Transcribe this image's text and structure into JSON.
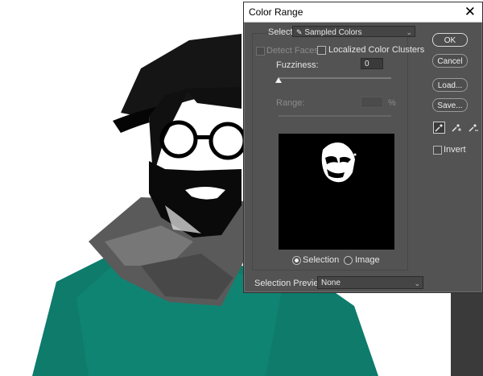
{
  "dialog": {
    "title": "Color Range",
    "close_glyph": "✕",
    "select_label": "Select:",
    "select_value": "Sampled Colors",
    "detect_faces_label": "Detect Faces",
    "localized_clusters_label": "Localized Color Clusters",
    "fuzziness_label": "Fuzziness:",
    "fuzziness_value": "0",
    "range_label": "Range:",
    "range_unit": "%",
    "selection_radio_label": "Selection",
    "image_radio_label": "Image",
    "selection_preview_label": "Selection Preview:",
    "selection_preview_value": "None",
    "fuzziness_level": 0,
    "buttons": {
      "ok": "OK",
      "cancel": "Cancel",
      "load": "Load...",
      "save": "Save..."
    },
    "invert_label": "Invert",
    "icons": [
      "eyedropper-icon",
      "eyedropper-plus-icon",
      "eyedropper-minus-icon"
    ]
  }
}
